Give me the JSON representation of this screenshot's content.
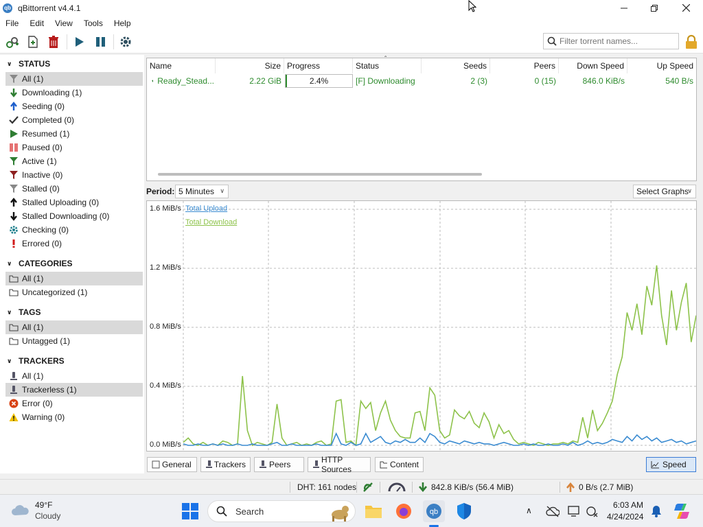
{
  "window": {
    "title": "qBittorrent v4.4.1",
    "app_icon": "qb"
  },
  "menu": [
    "File",
    "Edit",
    "View",
    "Tools",
    "Help"
  ],
  "search": {
    "placeholder": "Filter torrent names..."
  },
  "sidebar": {
    "status_header": "STATUS",
    "status_items": [
      {
        "label": "All (1)",
        "icon": "filter-icon",
        "color": "#888888"
      },
      {
        "label": "Downloading (1)",
        "icon": "down-arrow-icon",
        "color": "#2e7d32"
      },
      {
        "label": "Seeding (0)",
        "icon": "up-arrow-icon",
        "color": "#1e5fcc"
      },
      {
        "label": "Completed (0)",
        "icon": "check-icon",
        "color": "#333333"
      },
      {
        "label": "Resumed (1)",
        "icon": "play-icon",
        "color": "#2e7d32"
      },
      {
        "label": "Paused (0)",
        "icon": "pause-icon",
        "color": "#e57373"
      },
      {
        "label": "Active (1)",
        "icon": "filter-icon",
        "color": "#2e7d32"
      },
      {
        "label": "Inactive (0)",
        "icon": "filter-icon",
        "color": "#8e2020"
      },
      {
        "label": "Stalled (0)",
        "icon": "filter-icon",
        "color": "#888888"
      },
      {
        "label": "Stalled Uploading (0)",
        "icon": "up-arrow-icon",
        "color": "#111111"
      },
      {
        "label": "Stalled Downloading (0)",
        "icon": "down-arrow-icon",
        "color": "#111111"
      },
      {
        "label": "Checking (0)",
        "icon": "gear-icon",
        "color": "#1e7f8c"
      },
      {
        "label": "Errored (0)",
        "icon": "exclamation-icon",
        "color": "#d11a1a"
      }
    ],
    "categories_header": "CATEGORIES",
    "categories_items": [
      {
        "label": "All (1)",
        "icon": "folder-icon"
      },
      {
        "label": "Uncategorized (1)",
        "icon": "folder-icon"
      }
    ],
    "tags_header": "TAGS",
    "tags_items": [
      {
        "label": "All (1)",
        "icon": "folder-icon"
      },
      {
        "label": "Untagged (1)",
        "icon": "folder-icon"
      }
    ],
    "trackers_header": "TRACKERS",
    "trackers_items": [
      {
        "label": "All (1)",
        "icon": "tracker-icon"
      },
      {
        "label": "Trackerless (1)",
        "icon": "tracker-icon"
      },
      {
        "label": "Error (0)",
        "icon": "error-icon"
      },
      {
        "label": "Warning (0)",
        "icon": "warning-icon"
      }
    ]
  },
  "table": {
    "columns": [
      "Name",
      "Size",
      "Progress",
      "Status",
      "Seeds",
      "Peers",
      "Down Speed",
      "Up Speed"
    ],
    "rows": [
      {
        "name": "Ready_Stead...",
        "size": "2.22 GiB",
        "progress": "2.4%",
        "progress_fraction": 0.024,
        "status": "[F] Downloading",
        "seeds": "2 (3)",
        "peers": "0 (15)",
        "down_speed": "846.0 KiB/s",
        "up_speed": "540 B/s"
      }
    ]
  },
  "period": {
    "label": "Period:",
    "value": "5 Minutes",
    "select_graphs": "Select Graphs"
  },
  "graph": {
    "y_labels": [
      "1.6 MiB/s",
      "1.2 MiB/s",
      "0.8 MiB/s",
      "0.4 MiB/s",
      "0.0 MiB/s"
    ],
    "legend_upload": "Total Upload",
    "legend_download": "Total Download",
    "upload_color": "#3a8bd1",
    "download_color": "#8dc24a"
  },
  "tabs": [
    "General",
    "Trackers",
    "Peers",
    "HTTP Sources",
    "Content"
  ],
  "speed_button": "Speed",
  "statusbar": {
    "dht": "DHT: 161 nodes",
    "download": "842.8 KiB/s (56.4 MiB)",
    "upload": "0 B/s (2.7 MiB)"
  },
  "taskbar": {
    "temperature": "49°F",
    "weather": "Cloudy",
    "search": "Search",
    "time": "6:03 AM",
    "date": "4/24/2024"
  }
}
